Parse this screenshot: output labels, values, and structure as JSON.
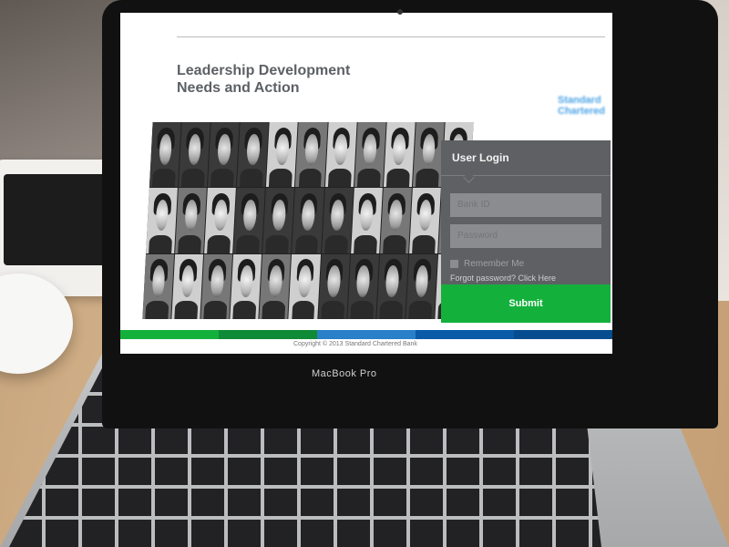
{
  "device": {
    "label": "MacBook Pro"
  },
  "page": {
    "title_line1": "Leadership Development",
    "title_line2": "Needs and Action",
    "logo": {
      "text_line1": "Standard",
      "text_line2": "Chartered"
    },
    "login": {
      "title": "User Login",
      "bank_id_placeholder": "Bank ID",
      "password_placeholder": "Password",
      "remember_label": "Remember Me",
      "forgot_text": "Forgot password? Click Here",
      "submit_label": "Submit"
    },
    "footer": {
      "copyright": "Copyright © 2013 Standard Chartered Bank"
    }
  },
  "colors": {
    "accent_green": "#14b03c",
    "stripe": [
      "#14b03c",
      "#0f8a36",
      "#2a7fc9",
      "#0a5aa8",
      "#064c8f"
    ],
    "panel": "#5e6063"
  },
  "photo_grid": {
    "columns": 11,
    "rows": 3
  }
}
